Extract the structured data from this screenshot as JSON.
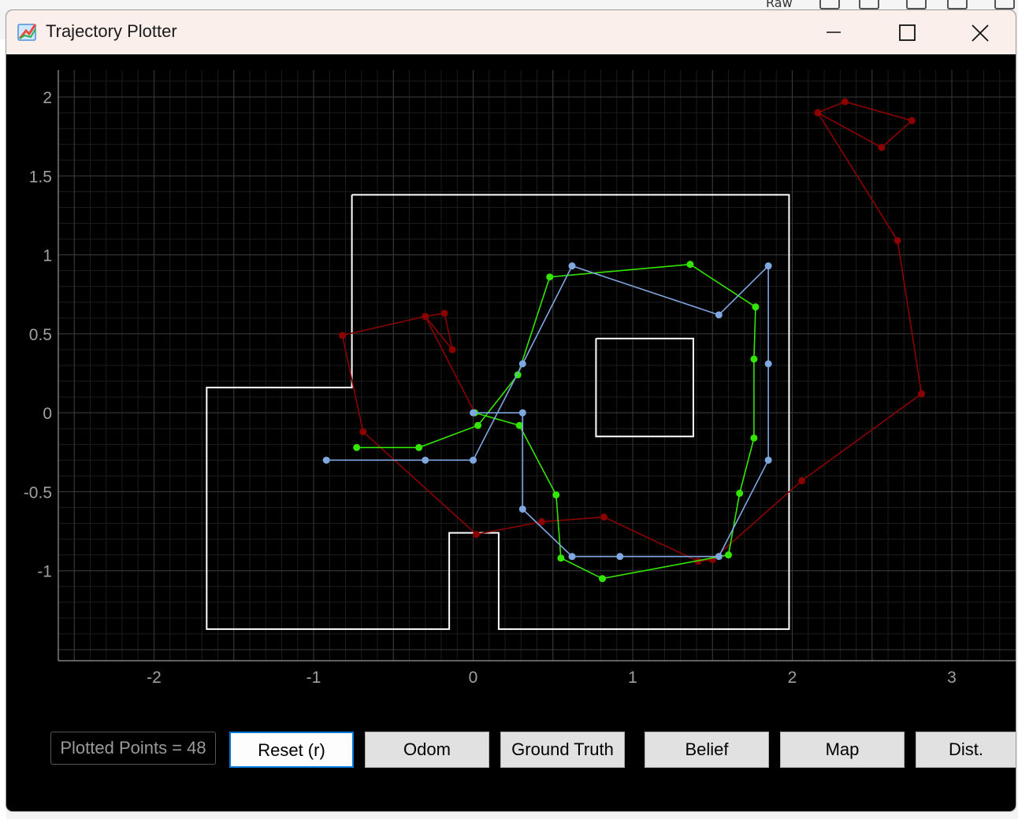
{
  "background": {
    "toolbar_text": "Raw"
  },
  "window": {
    "title": "Trajectory Plotter",
    "plotted_points_label": "Plotted Points = 48",
    "buttons": {
      "reset": "Reset (r)",
      "odom": "Odom",
      "ground_truth": "Ground Truth",
      "belief": "Belief",
      "map": "Map",
      "dist": "Dist."
    }
  },
  "colors": {
    "odom": "#8b0000",
    "ground_truth": "#33e600",
    "belief": "#7fa7e0",
    "map": "#ffffff",
    "grid_major": "#3a3a3a",
    "grid_minor": "#1c1c1c",
    "tick_text": "#a0a0a0"
  },
  "chart_data": {
    "type": "line",
    "xlim": [
      -2.6,
      3.4
    ],
    "ylim": [
      -1.57,
      2.17
    ],
    "x_ticks": [
      -2,
      -1,
      0,
      1,
      2,
      3
    ],
    "y_ticks": [
      2,
      1.5,
      1,
      0.5,
      0,
      -0.5,
      -1
    ],
    "x_tick_labels": [
      "-2",
      "-1",
      "0",
      "1",
      "2",
      "3"
    ],
    "y_tick_labels": [
      "2",
      "1.5",
      "1",
      "0.5",
      "0",
      "-0.5",
      "-1"
    ],
    "grid": true,
    "series": [
      {
        "key": "odom",
        "points": [
          [
            2.16,
            1.9
          ],
          [
            2.33,
            1.97
          ],
          [
            2.75,
            1.85
          ],
          [
            2.56,
            1.68
          ],
          [
            2.16,
            1.9
          ],
          [
            2.66,
            1.09
          ],
          [
            2.81,
            0.12
          ],
          [
            2.06,
            -0.43
          ],
          [
            1.5,
            -0.93
          ],
          [
            1.41,
            -0.94
          ],
          [
            0.82,
            -0.66
          ],
          [
            0.43,
            -0.69
          ],
          [
            0.02,
            -0.77
          ],
          [
            -0.69,
            -0.12
          ],
          [
            -0.82,
            0.49
          ],
          [
            -0.3,
            0.61
          ],
          [
            -0.18,
            0.63
          ],
          [
            -0.13,
            0.4
          ],
          [
            -0.3,
            0.61
          ],
          [
            0.01,
            0.0
          ]
        ]
      },
      {
        "key": "ground_truth",
        "points": [
          [
            -0.73,
            -0.22
          ],
          [
            -0.34,
            -0.22
          ],
          [
            0.03,
            -0.08
          ],
          [
            0.28,
            0.24
          ],
          [
            0.48,
            0.86
          ],
          [
            1.36,
            0.94
          ],
          [
            1.77,
            0.67
          ],
          [
            1.76,
            0.34
          ],
          [
            1.76,
            -0.16
          ],
          [
            1.67,
            -0.51
          ],
          [
            1.6,
            -0.9
          ],
          [
            0.81,
            -1.05
          ],
          [
            0.55,
            -0.92
          ],
          [
            0.52,
            -0.52
          ],
          [
            0.29,
            -0.08
          ],
          [
            0.01,
            0.0
          ]
        ]
      },
      {
        "key": "belief",
        "points": [
          [
            -0.92,
            -0.3
          ],
          [
            -0.3,
            -0.3
          ],
          [
            0.0,
            -0.3
          ],
          [
            0.31,
            0.31
          ],
          [
            0.62,
            0.93
          ],
          [
            1.54,
            0.62
          ],
          [
            1.85,
            0.93
          ],
          [
            1.85,
            0.31
          ],
          [
            1.85,
            -0.3
          ],
          [
            1.54,
            -0.91
          ],
          [
            0.92,
            -0.91
          ],
          [
            0.62,
            -0.91
          ],
          [
            0.31,
            -0.61
          ],
          [
            0.31,
            0.0
          ],
          [
            0.0,
            0.0
          ]
        ]
      }
    ],
    "map_walls": [
      [
        [
          -0.76,
          1.38
        ],
        [
          1.98,
          1.38
        ],
        [
          1.98,
          -1.37
        ],
        [
          0.16,
          -1.37
        ],
        [
          0.16,
          -0.76
        ],
        [
          -0.15,
          -0.76
        ],
        [
          -0.15,
          -1.37
        ],
        [
          -1.67,
          -1.37
        ],
        [
          -1.67,
          0.16
        ],
        [
          -0.76,
          0.16
        ],
        [
          -0.76,
          1.38
        ]
      ],
      [
        [
          0.77,
          0.47
        ],
        [
          1.38,
          0.47
        ],
        [
          1.38,
          -0.15
        ],
        [
          0.77,
          -0.15
        ],
        [
          0.77,
          0.47
        ]
      ]
    ]
  }
}
